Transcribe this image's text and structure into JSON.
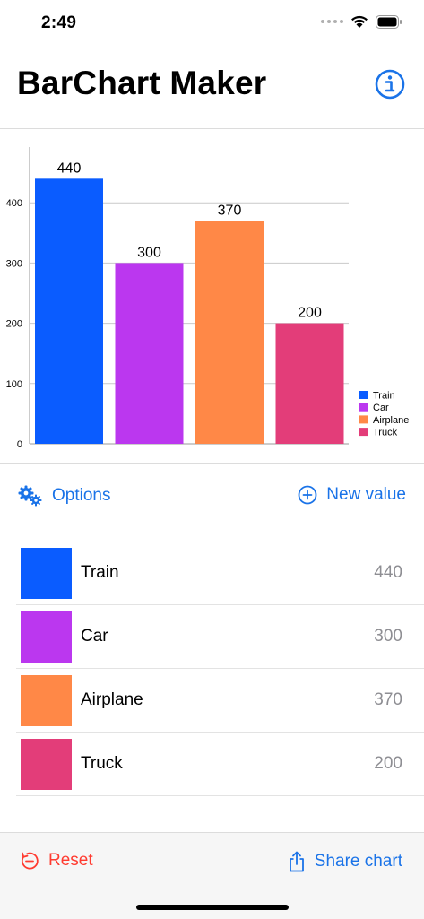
{
  "status_bar": {
    "time": "2:49"
  },
  "header": {
    "title": "BarChart Maker",
    "info_icon": "info-circle-icon"
  },
  "chart_data": {
    "type": "bar",
    "categories": [
      "Train",
      "Car",
      "Airplane",
      "Truck"
    ],
    "values": [
      440,
      300,
      370,
      200
    ],
    "colors": [
      "#0a5cff",
      "#bb37ef",
      "#ff8847",
      "#e33d79"
    ],
    "ylim": [
      0,
      500
    ],
    "y_ticks": [
      "0",
      "100",
      "200",
      "300",
      "400"
    ],
    "data_labels": [
      "440",
      "300",
      "370",
      "200"
    ],
    "grid": true,
    "legend": "bottom-right",
    "title": "",
    "xlabel": "",
    "ylabel": ""
  },
  "actions": {
    "options_label": "Options",
    "new_value_label": "New value"
  },
  "items": [
    {
      "label": "Train",
      "value": "440",
      "color": "#0a5cff"
    },
    {
      "label": "Car",
      "value": "300",
      "color": "#bb37ef"
    },
    {
      "label": "Airplane",
      "value": "370",
      "color": "#ff8847"
    },
    {
      "label": "Truck",
      "value": "200",
      "color": "#e33d79"
    }
  ],
  "toolbar": {
    "reset_label": "Reset",
    "share_label": "Share chart"
  },
  "accent_color": "#1a73e8",
  "destructive_color": "#ff3b30"
}
